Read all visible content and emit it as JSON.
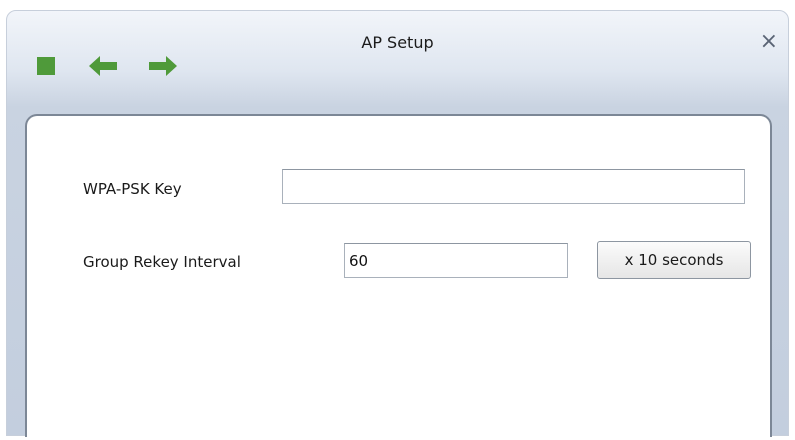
{
  "window": {
    "title": "AP Setup",
    "close_glyph": "×"
  },
  "toolbar": {
    "icons": [
      "stop-icon",
      "arrow-left-icon",
      "arrow-right-icon"
    ],
    "icon_color": "#4f9a3a"
  },
  "form": {
    "wpa_psk": {
      "label": "WPA-PSK Key",
      "value": ""
    },
    "group_rekey": {
      "label": "Group Rekey Interval",
      "value": "60",
      "units_button": "x 10 seconds"
    }
  }
}
